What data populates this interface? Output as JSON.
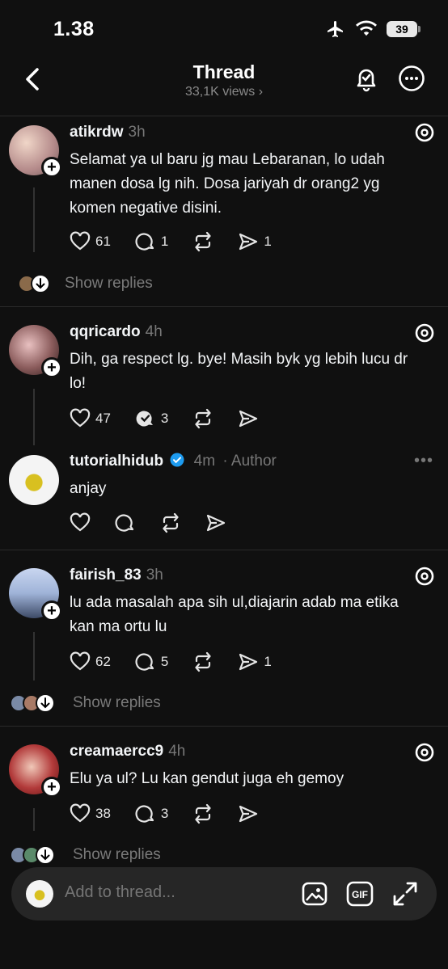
{
  "status_bar": {
    "time": "1.38",
    "battery": "39"
  },
  "header": {
    "title": "Thread",
    "views": "33,1K views"
  },
  "posts": [
    {
      "username": "atikrdw",
      "time": "3h",
      "text": "Selamat ya ul baru jg mau Lebaranan, lo udah manen dosa lg nih. Dosa jariyah dr orang2 yg komen negative disini.",
      "likes": "61",
      "replies": "1",
      "shares": "1",
      "show_replies": "Show replies"
    },
    {
      "username": "qqricardo",
      "time": "4h",
      "text": "Dih, ga respect lg. bye! Masih byk yg lebih lucu dr lo!",
      "likes": "47",
      "replies": "3"
    },
    {
      "username": "tutorialhidub",
      "time": "4m",
      "author_label": "· Author",
      "text": "anjay"
    },
    {
      "username": "fairish_83",
      "time": "3h",
      "text": "lu ada masalah apa sih ul,diajarin adab ma etika kan ma ortu lu",
      "likes": "62",
      "replies": "5",
      "shares": "1",
      "show_replies": "Show replies"
    },
    {
      "username": "creamaercc9",
      "time": "4h",
      "text": "Elu ya ul? Lu kan gendut juga eh gemoy",
      "likes": "38",
      "replies": "3",
      "show_replies": "Show replies"
    }
  ],
  "composer": {
    "placeholder": "Add to thread..."
  },
  "colors": {
    "background": "#101010",
    "verified": "#1d9bf0",
    "muted": "#7a7a7a"
  }
}
